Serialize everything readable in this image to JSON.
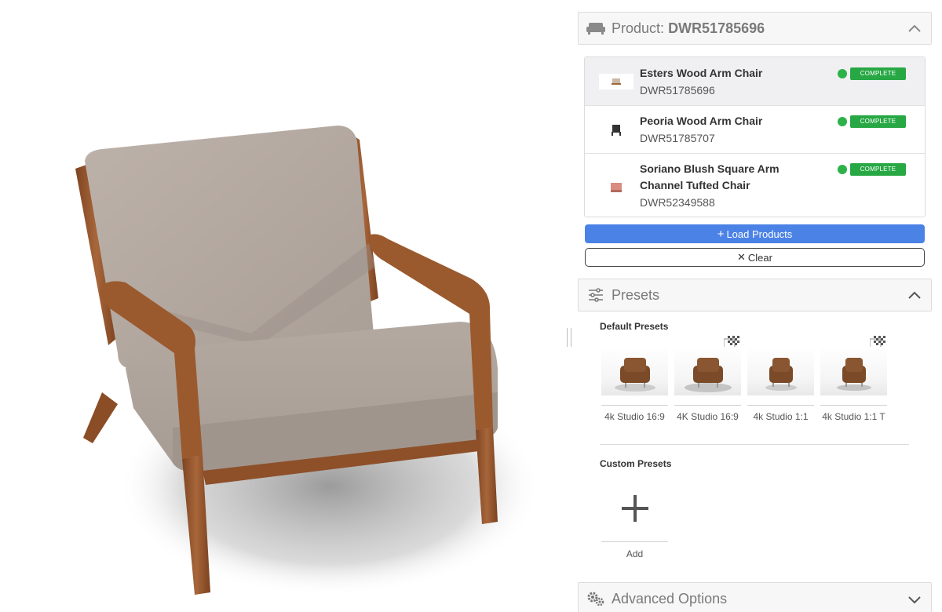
{
  "product_section": {
    "title_prefix": "Product:",
    "title_sku": "DWR51785696"
  },
  "products": [
    {
      "name": "Esters Wood Arm Chair",
      "sku": "DWR51785696",
      "status": "COMPLETE",
      "selected": true
    },
    {
      "name": "Peoria Wood Arm Chair",
      "sku": "DWR51785707",
      "status": "COMPLETE",
      "selected": false
    },
    {
      "name": "Soriano Blush Square Arm Channel Tufted Chair",
      "sku": "DWR52349588",
      "status": "COMPLETE",
      "selected": false
    }
  ],
  "buttons": {
    "load_products": "Load Products",
    "clear": "Clear"
  },
  "presets_section": {
    "title": "Presets",
    "default_heading": "Default Presets",
    "custom_heading": "Custom Presets",
    "add_label": "Add"
  },
  "default_presets": [
    {
      "label": "4k Studio 16:9",
      "transparent": false
    },
    {
      "label": "4K Studio 16:9",
      "transparent": true
    },
    {
      "label": "4k Studio 1:1",
      "transparent": false
    },
    {
      "label": "4k Studio 1:1 T",
      "transparent": true
    }
  ],
  "advanced_section": {
    "title": "Advanced Options"
  },
  "colors": {
    "accent": "#4b82e6",
    "status_complete": "#27a844",
    "upholstery": "#b5aaa2",
    "wood": "#9a5a2e"
  }
}
